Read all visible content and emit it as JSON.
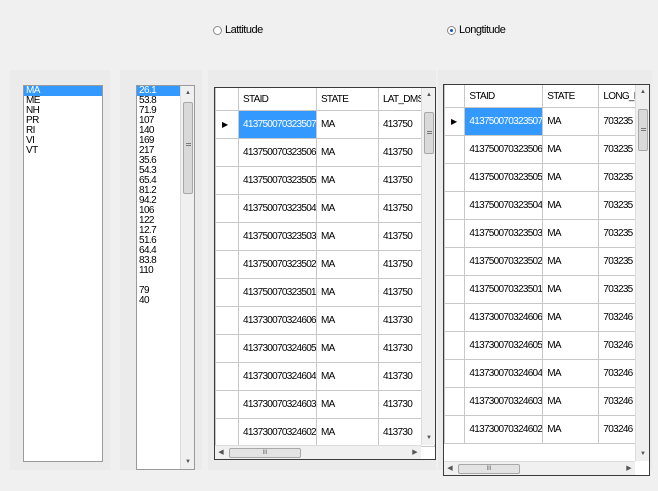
{
  "radios": {
    "latitude": {
      "label": "Lattitude",
      "selected": false
    },
    "longitude": {
      "label": "Longtitude",
      "selected": true
    }
  },
  "states_list": {
    "items": [
      "MA",
      "ME",
      "NH",
      "PR",
      "RI",
      "VI",
      "VT"
    ],
    "selected_index": 0
  },
  "values_list": {
    "items": [
      "26.1",
      "53.8",
      "71.9",
      "107",
      "140",
      "169",
      "217",
      "35.6",
      "54.3",
      "65.4",
      "81.2",
      "94.2",
      "106",
      "122",
      "12.7",
      "51.6",
      "64.4",
      "83.8",
      "110",
      "",
      "79",
      "40"
    ],
    "selected_index": 0
  },
  "lat_grid": {
    "columns": [
      "STAID",
      "STATE",
      "LAT_DMS"
    ],
    "rows": [
      [
        "413750070323507",
        "MA",
        "413750"
      ],
      [
        "413750070323506",
        "MA",
        "413750"
      ],
      [
        "413750070323505",
        "MA",
        "413750"
      ],
      [
        "413750070323504",
        "MA",
        "413750"
      ],
      [
        "413750070323503",
        "MA",
        "413750"
      ],
      [
        "413750070323502",
        "MA",
        "413750"
      ],
      [
        "413750070323501",
        "MA",
        "413750"
      ],
      [
        "413730070324606",
        "MA",
        "413730"
      ],
      [
        "413730070324605",
        "MA",
        "413730"
      ],
      [
        "413730070324604",
        "MA",
        "413730"
      ],
      [
        "413730070324603",
        "MA",
        "413730"
      ],
      [
        "413730070324602",
        "MA",
        "413730"
      ]
    ],
    "current_row_indicator": "▶"
  },
  "long_grid": {
    "columns": [
      "STAID",
      "STATE",
      "LONG_DN"
    ],
    "rows": [
      [
        "413750070323507",
        "MA",
        "703235"
      ],
      [
        "413750070323506",
        "MA",
        "703235"
      ],
      [
        "413750070323505",
        "MA",
        "703235"
      ],
      [
        "413750070323504",
        "MA",
        "703235"
      ],
      [
        "413750070323503",
        "MA",
        "703235"
      ],
      [
        "413750070323502",
        "MA",
        "703235"
      ],
      [
        "413750070323501",
        "MA",
        "703235"
      ],
      [
        "413730070324606",
        "MA",
        "703246"
      ],
      [
        "413730070324605",
        "MA",
        "703246"
      ],
      [
        "413730070324604",
        "MA",
        "703246"
      ],
      [
        "413730070324603",
        "MA",
        "703246"
      ],
      [
        "413730070324602",
        "MA",
        "703246"
      ]
    ],
    "current_row_indicator": "▶"
  },
  "colors": {
    "selection": "#3399ff",
    "grid_border": "#3a3a3a"
  }
}
